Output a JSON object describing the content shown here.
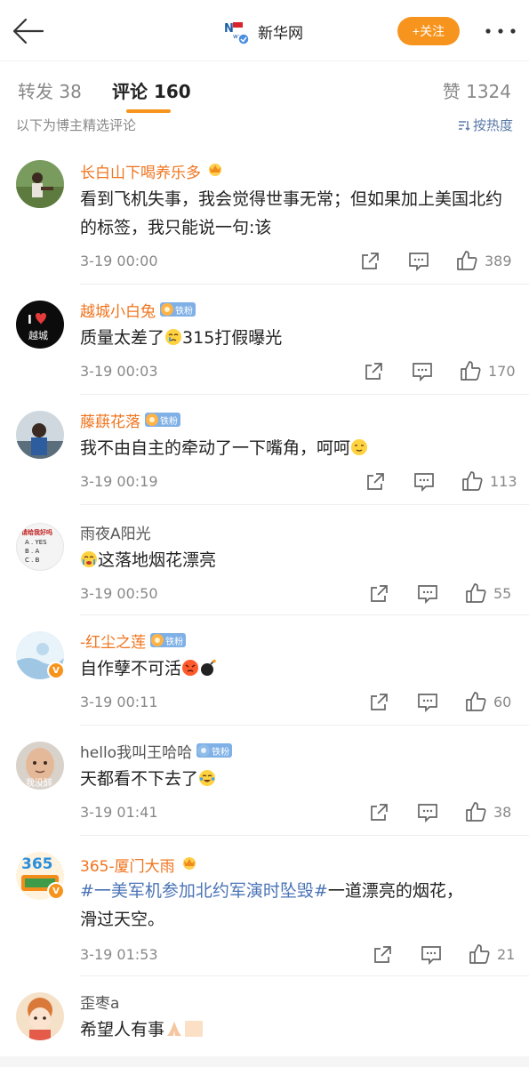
{
  "header": {
    "title": "新华网",
    "follow_label": "+关注",
    "logo_text": "新华网 News"
  },
  "tabs": {
    "repost": "转发 38",
    "comments": "评论 160",
    "likes": "赞 1324"
  },
  "subbar": {
    "note": "以下为博主精选评论",
    "sort_label": "按热度"
  },
  "comments": [
    {
      "name": "长白山下喝养乐多",
      "text": "看到飞机失事，我会觉得世事无常；但如果加上美国北约的标签，我只能说一句:该",
      "time": "3-19 00:00",
      "likes": "389"
    },
    {
      "name": "越城小白兔",
      "fan": "铁粉",
      "text": "质量太差了",
      "text_tail": "315打假曝光",
      "time": "3-19 00:03",
      "likes": "170",
      "avatar_text": "越城"
    },
    {
      "name": "藤蕻花落",
      "fan": "铁粉",
      "text": "我不由自主的牵动了一下嘴角，呵呵",
      "time": "3-19 00:19",
      "likes": "113"
    },
    {
      "name": "雨夜A阳光",
      "text": "这落地烟花漂亮",
      "time": "3-19 00:50",
      "likes": "55",
      "avatar_lines": [
        "请给我好吗",
        "A . YES",
        "B . A",
        "C . B"
      ]
    },
    {
      "name": "-红尘之莲",
      "fan": "铁粉",
      "text": "自作孽不可活",
      "time": "3-19 00:11",
      "likes": "60"
    },
    {
      "name": "hello我叫王哈哈",
      "fan": "铁粉",
      "text": "天都看不下去了",
      "time": "3-19 01:41",
      "likes": "38",
      "avatar_text": "我没醉"
    },
    {
      "name": "365-厦门大雨",
      "topic": "#一美军机参加北约军演时坠毁#",
      "text_line1": "一道漂亮的烟花，",
      "text_line2": "滑过天空。",
      "time": "3-19 01:53",
      "likes": "21",
      "avatar_text": "365"
    },
    {
      "name": "歪枣a",
      "text": "希望人有事",
      "time": "",
      "likes": ""
    }
  ],
  "icons": {
    "back": "back-arrow-icon",
    "more": "more-dots-icon",
    "sort": "sort-icon",
    "share": "share-icon",
    "comment": "comment-icon",
    "like": "thumbs-up-icon",
    "crown": "crown-badge-icon",
    "verified": "verified-v-icon"
  },
  "colors": {
    "accent": "#f7941d",
    "username": "#f0741d",
    "link": "#4a73b6",
    "fan_badge": "#7fb0e6"
  }
}
